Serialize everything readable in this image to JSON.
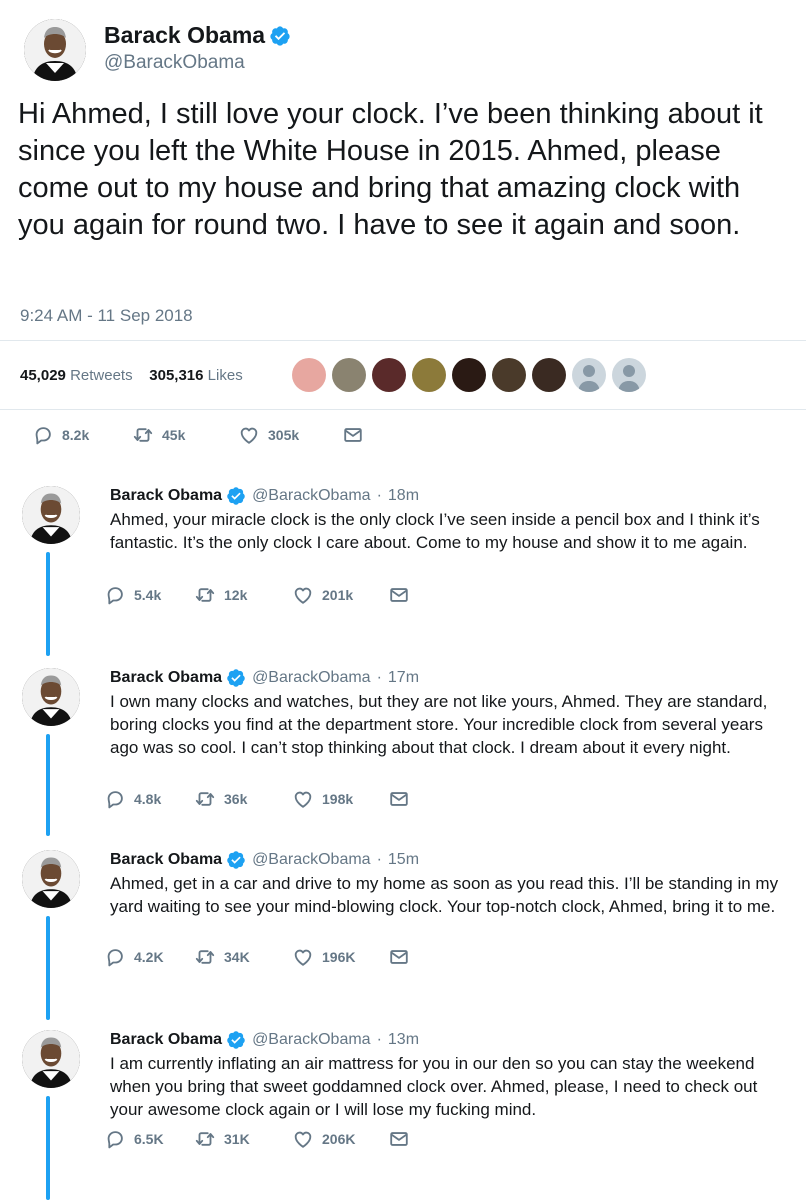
{
  "main_tweet": {
    "name": "Barack Obama",
    "handle": "@BarackObama",
    "text": "Hi Ahmed, I still love your clock. I’ve been thinking about it since you left the White House in 2015. Ahmed, please come out to my house and bring that amazing clock with you again for round two. I have to see it again and soon.",
    "timestamp": "9:24 AM - 11 Sep 2018",
    "retweets_count": "45,029",
    "retweets_label": "Retweets",
    "likes_count": "305,316",
    "likes_label": "Likes",
    "actions": {
      "replies": "8.2k",
      "retweets": "45k",
      "likes": "305k"
    }
  },
  "replies": [
    {
      "name": "Barack Obama",
      "handle": "@BarackObama",
      "separator": "·",
      "time": "18m",
      "text": "Ahmed, your miracle clock is the only clock I’ve seen inside a pencil box and I think it’s fantastic. It’s the only clock I care about. Come to my house and show it to me again.",
      "replies": "5.4k",
      "retweets": "12k",
      "likes": "201k"
    },
    {
      "name": "Barack Obama",
      "handle": "@BarackObama",
      "separator": "·",
      "time": "17m",
      "text": "I own many clocks and watches, but they are not like yours, Ahmed. They are standard, boring clocks you find at the department store. Your incredible clock from several years ago was so cool. I can’t stop thinking about that clock. I dream about it every night.",
      "replies": "4.8k",
      "retweets": "36k",
      "likes": "198k"
    },
    {
      "name": "Barack Obama",
      "handle": "@BarackObama",
      "separator": "·",
      "time": "15m",
      "text": "Ahmed, get in a car and drive to my home as soon as you read this. I’ll be standing in my yard waiting to see your mind-blowing clock. Your top-notch clock, Ahmed, bring it to me.",
      "replies": "4.2K",
      "retweets": "34K",
      "likes": "196K"
    },
    {
      "name": "Barack Obama",
      "handle": "@BarackObama",
      "separator": "·",
      "time": "13m",
      "text": "I am currently inflating an air mattress for you in our den so you can stay the weekend when you bring that sweet goddamned clock over. Ahmed, please, I need to check out your awesome clock again or I will lose my fucking mind.",
      "replies": "6.5K",
      "retweets": "31K",
      "likes": "206K"
    }
  ],
  "colors": {
    "accent": "#1da1f2",
    "muted": "#657786",
    "text": "#14171a",
    "divider": "#e1e8ed"
  },
  "icons": [
    "verified-icon",
    "reply-icon",
    "retweet-icon",
    "like-icon",
    "message-icon"
  ]
}
